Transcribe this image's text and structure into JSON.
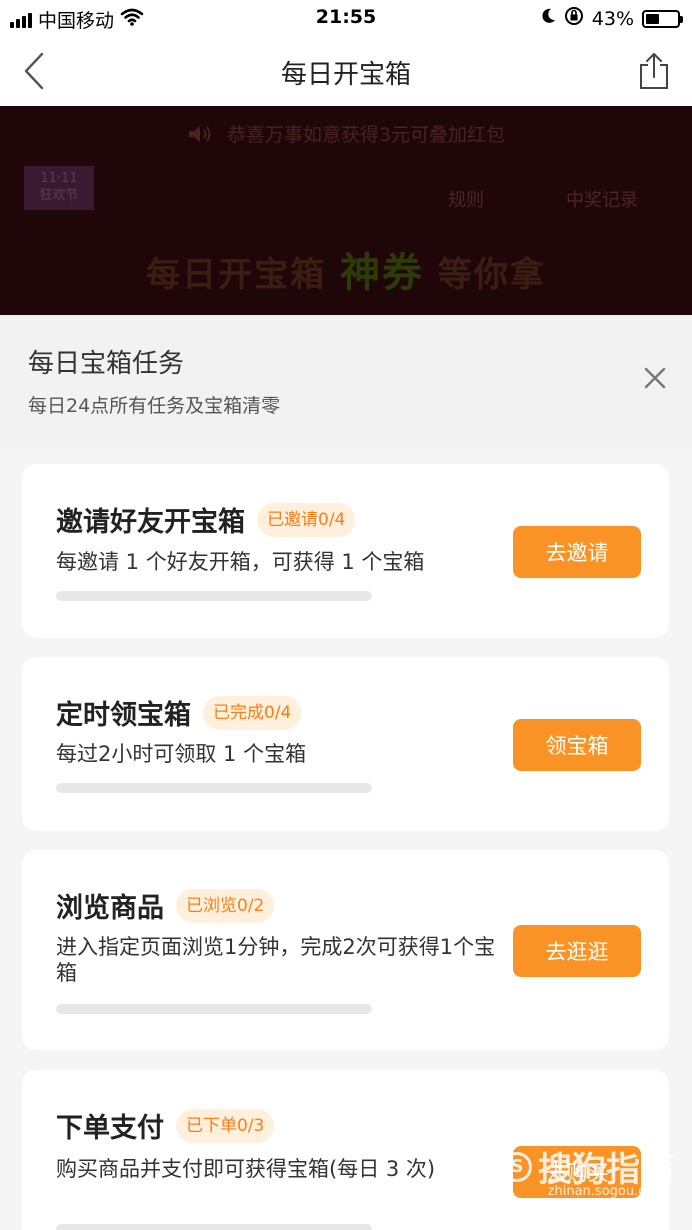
{
  "status_bar": {
    "carrier": "中国移动",
    "time": "21:55",
    "battery": "43%",
    "battery_level": 0.43,
    "icons": [
      "signal-icon",
      "wifi-icon",
      "moon-icon",
      "orientation-lock-icon",
      "battery-icon"
    ]
  },
  "nav": {
    "title": "每日开宝箱",
    "icons": [
      "back-arrow-icon",
      "share-icon"
    ]
  },
  "banner": {
    "notice": "恭喜万事如意获得3元可叠加红包",
    "logo_top": "11·11",
    "logo_bottom": "狂欢节",
    "rules": "规则",
    "records": "中奖记录",
    "slogan_start": "每日开宝箱",
    "slogan_highlight": "神券",
    "slogan_end": "等你拿"
  },
  "sheet": {
    "title": "每日宝箱任务",
    "subtitle": "每日24点所有任务及宝箱清零"
  },
  "tasks": [
    {
      "title": "邀请好友开宝箱",
      "badge": "已邀请0/4",
      "desc": "每邀请 1 个好友开箱，可获得 1 个宝箱",
      "button": "去邀请",
      "progress": 0
    },
    {
      "title": "定时领宝箱",
      "badge": "已完成0/4",
      "desc": "每过2小时可领取 1 个宝箱",
      "button": "领宝箱",
      "progress": 0
    },
    {
      "title": "浏览商品",
      "badge": "已浏览0/2",
      "desc": "进入指定页面浏览1分钟，完成2次可获得1个宝箱",
      "button": "去逛逛",
      "progress": 0
    },
    {
      "title": "下单支付",
      "badge": "已下单0/3",
      "desc": "购买商品并支付即可获得宝箱(每日 3 次)",
      "button": "去购买",
      "progress": 0
    }
  ],
  "watermark": {
    "text": "搜狗指南",
    "url": "zhinan.sogou.com"
  },
  "colors": {
    "accent": "#fa9326",
    "badge_text": "#ff7d12",
    "badge_bg": "#fff0de"
  }
}
